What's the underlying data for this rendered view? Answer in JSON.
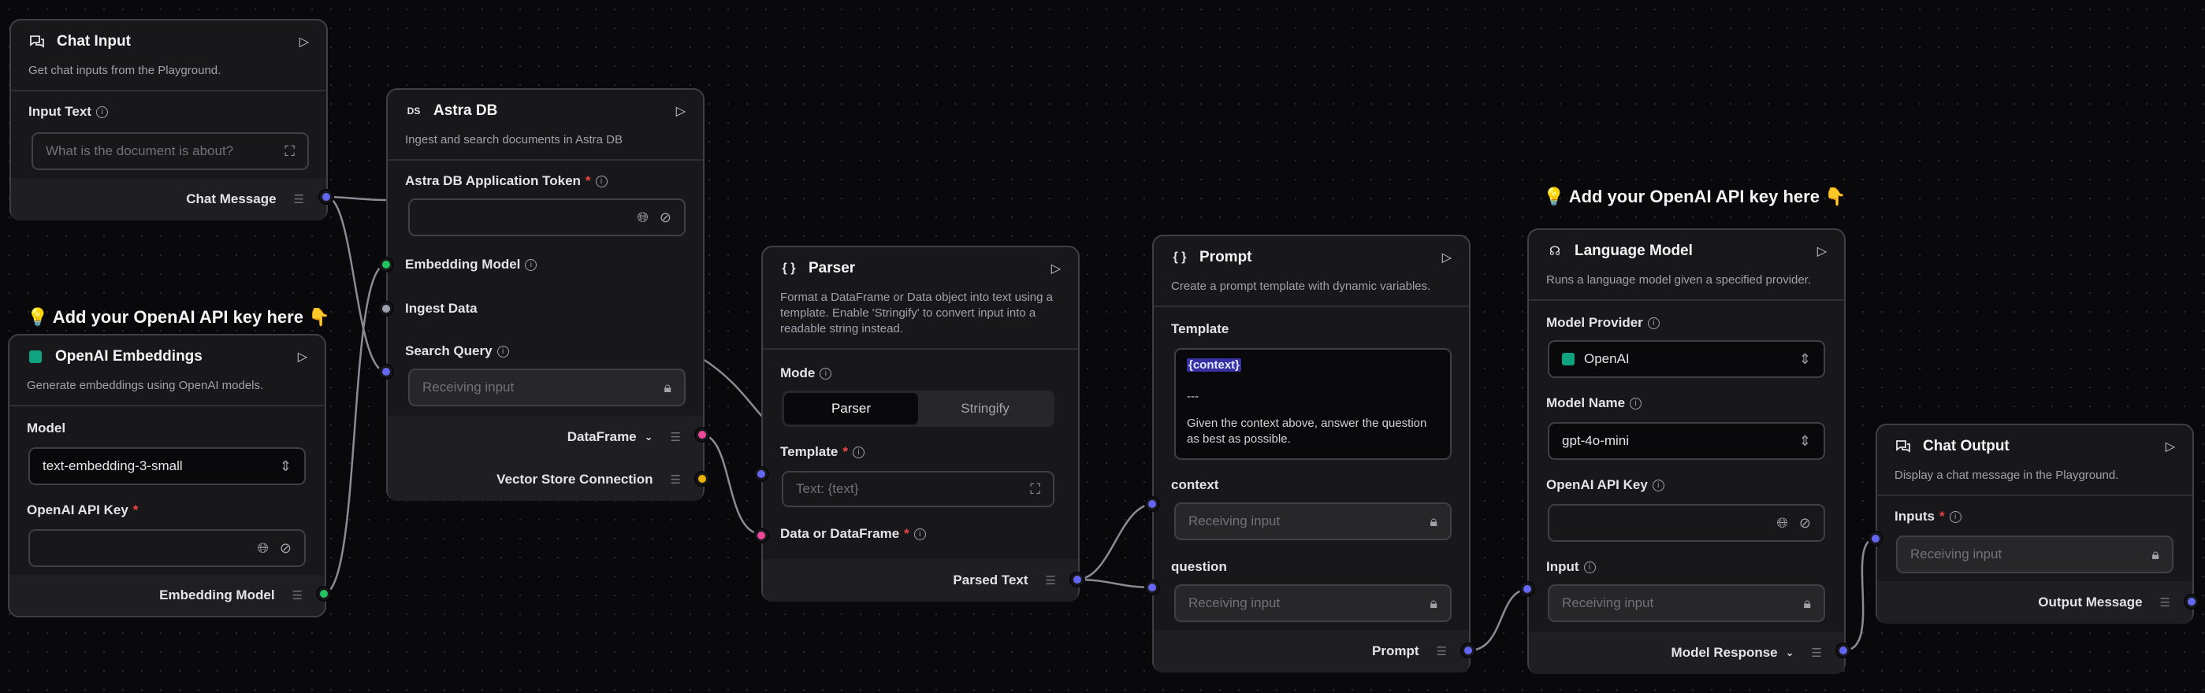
{
  "notes": {
    "left": "💡 Add your OpenAI API key here 👇",
    "right": "💡 Add your OpenAI API key here 👇"
  },
  "chat_input": {
    "title": "Chat Input",
    "description": "Get chat inputs from the Playground.",
    "input_label": "Input Text",
    "input_placeholder": "What is the document is about?",
    "output_label": "Chat Message"
  },
  "openai_embeddings": {
    "title": "OpenAI Embeddings",
    "description": "Generate embeddings using OpenAI models.",
    "model_label": "Model",
    "model_value": "text-embedding-3-small",
    "key_label": "OpenAI API Key",
    "output_label": "Embedding Model"
  },
  "astra_db": {
    "title": "Astra DB",
    "icon_text": "DS",
    "description": "Ingest and search documents in Astra DB",
    "token_label": "Astra DB Application Token",
    "embedding_label": "Embedding Model",
    "ingest_label": "Ingest Data",
    "search_label": "Search Query",
    "search_placeholder": "Receiving input",
    "output_dataframe": "DataFrame",
    "output_vector": "Vector Store Connection"
  },
  "parser": {
    "title": "Parser",
    "description": "Format a DataFrame or Data object into text using a template. Enable 'Stringify' to convert input into a readable string instead.",
    "mode_label": "Mode",
    "mode_options": [
      "Parser",
      "Stringify"
    ],
    "template_label": "Template",
    "template_placeholder": "Text: {text}",
    "data_label": "Data or DataFrame",
    "output_label": "Parsed Text"
  },
  "prompt": {
    "title": "Prompt",
    "description": "Create a prompt template with dynamic variables.",
    "template_label": "Template",
    "template_var": "{context}",
    "template_sep": "---",
    "template_text": "Given the context above, answer the question as best as possible.",
    "context_label": "context",
    "context_placeholder": "Receiving input",
    "question_label": "question",
    "question_placeholder": "Receiving input",
    "output_label": "Prompt"
  },
  "language_model": {
    "title": "Language Model",
    "description": "Runs a language model given a specified provider.",
    "provider_label": "Model Provider",
    "provider_value": "OpenAI",
    "model_label": "Model Name",
    "model_value": "gpt-4o-mini",
    "key_label": "OpenAI API Key",
    "input_label": "Input",
    "input_placeholder": "Receiving input",
    "output_label": "Model Response"
  },
  "chat_output": {
    "title": "Chat Output",
    "description": "Display a chat message in the Playground.",
    "inputs_label": "Inputs",
    "inputs_placeholder": "Receiving input",
    "output_label": "Output Message"
  },
  "colors": {
    "blue": "#6366f1",
    "green": "#22c55e",
    "pink": "#ec4899",
    "yellow": "#eab308",
    "edge": "#a1a1aa"
  }
}
